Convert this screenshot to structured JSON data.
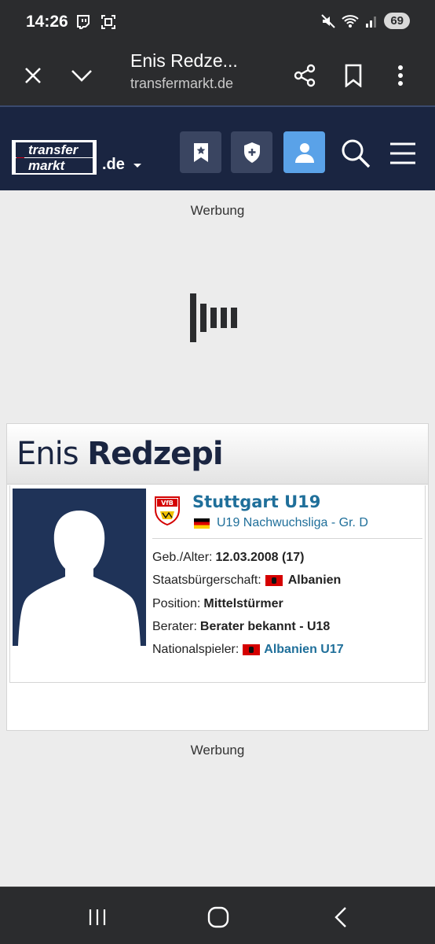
{
  "status": {
    "time": "14:26",
    "battery": "69"
  },
  "browser": {
    "title": "Enis Redze...",
    "url": "transfermarkt.de"
  },
  "site": {
    "logo_top": "transfer",
    "logo_bottom": "markt",
    "tld": ".de"
  },
  "ads": {
    "label_top": "Werbung",
    "label_bottom": "Werbung"
  },
  "player": {
    "first_name": "Enis",
    "last_name": "Redzepi",
    "club": "Stuttgart U19",
    "league": "U19 Nachwuchsliga - Gr. D",
    "birth_label": "Geb./Alter:",
    "birth_value": "12.03.2008 (17)",
    "citizenship_label": "Staatsbürgerschaft:",
    "citizenship_value": "Albanien",
    "position_label": "Position:",
    "position_value": "Mittelstürmer",
    "agent_label": "Berater:",
    "agent_value": "Berater bekannt - U18",
    "national_label": "Nationalspieler:",
    "national_value": "Albanien U17"
  },
  "colors": {
    "header_bg": "#1a2541",
    "accent": "#5aa2e8",
    "link": "#1f6f9a"
  }
}
